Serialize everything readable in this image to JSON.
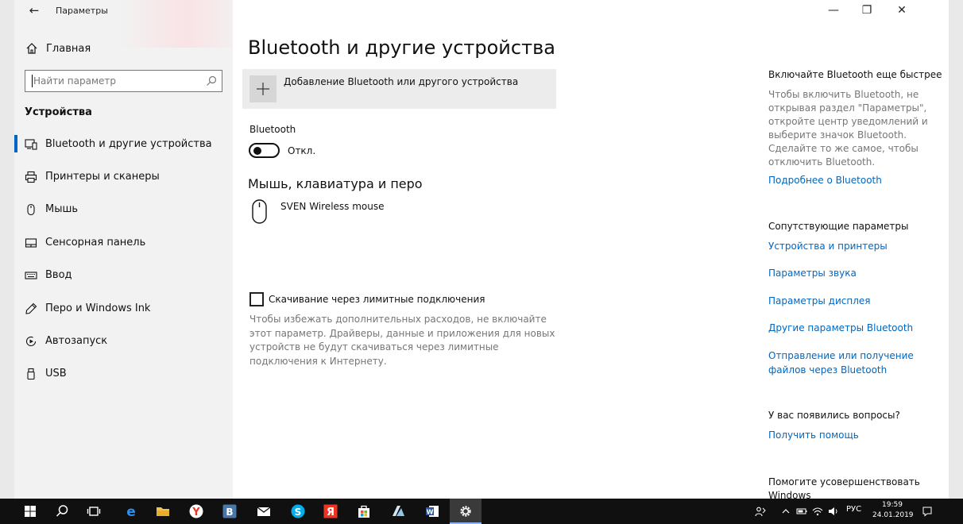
{
  "window": {
    "title": "Параметры",
    "controls": {
      "minimize": "—",
      "maximize": "❐",
      "close": "✕"
    }
  },
  "sidebar": {
    "home": "Главная",
    "search_placeholder": "Найти параметр",
    "section": "Устройства",
    "items": [
      {
        "label": "Bluetooth и другие устройства",
        "icon": "devices-icon",
        "active": true
      },
      {
        "label": "Принтеры и сканеры",
        "icon": "printer-icon"
      },
      {
        "label": "Мышь",
        "icon": "mouse-icon"
      },
      {
        "label": "Сенсорная панель",
        "icon": "touchpad-icon"
      },
      {
        "label": "Ввод",
        "icon": "keyboard-icon"
      },
      {
        "label": "Перо и Windows Ink",
        "icon": "pen-icon"
      },
      {
        "label": "Автозапуск",
        "icon": "autoplay-icon"
      },
      {
        "label": "USB",
        "icon": "usb-icon"
      }
    ]
  },
  "main": {
    "title": "Bluetooth и другие устройства",
    "add_device": "Добавление Bluetooth или другого устройства",
    "bluetooth_label": "Bluetooth",
    "bluetooth_state": "Откл.",
    "bluetooth_on": false,
    "mouse_section": "Мышь, клавиатура и перо",
    "device_name": "SVEN Wireless mouse",
    "metered_label": "Скачивание через лимитные подключения",
    "metered_checked": false,
    "metered_desc": "Чтобы избежать дополнительных расходов, не включайте этот параметр. Драйверы, данные и приложения для новых устройств не будут скачиваться через лимитные подключения к Интернету."
  },
  "right_panel": {
    "faster_title": "Включайте Bluetooth еще быстрее",
    "faster_text": "Чтобы включить Bluetooth, не открывая раздел \"Параметры\", откройте центр уведомлений и выберите значок Bluetooth. Сделайте то же самое, чтобы отключить Bluetooth.",
    "more_link": "Подробнее о Bluetooth",
    "related_title": "Сопутствующие параметры",
    "related_links": [
      "Устройства и принтеры",
      "Параметры звука",
      "Параметры дисплея",
      "Другие параметры Bluetooth",
      "Отправление или получение файлов через Bluetooth"
    ],
    "questions_title": "У вас появились вопросы?",
    "help_link": "Получить помощь",
    "improve_title": "Помогите усовершенствовать Windows"
  },
  "taskbar": {
    "apps": [
      "start",
      "search",
      "task-view",
      "edge",
      "explorer",
      "yandex-browser",
      "vk",
      "mail",
      "skype",
      "yandex",
      "store",
      "azure",
      "word",
      "settings"
    ],
    "language": "РУС",
    "time": "19:59",
    "date": "24.01.2019"
  },
  "colors": {
    "accent": "#0067c0",
    "taskbar": "#101010",
    "sidebar": "#f2f2f2"
  }
}
